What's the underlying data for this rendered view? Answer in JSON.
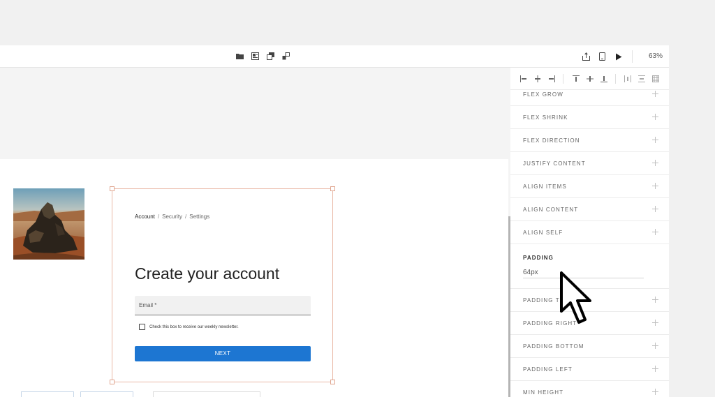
{
  "toolbar": {
    "center_icons": [
      "folder-icon",
      "layout-icon",
      "layers-icon",
      "components-icon"
    ],
    "right_icons": [
      "share-icon",
      "device-icon",
      "play-icon"
    ],
    "zoom": "63%"
  },
  "form": {
    "breadcrumb": [
      "Account",
      "Security",
      "Settings"
    ],
    "breadcrumb_separator": "/",
    "title": "Create your account",
    "email_label": "Email *",
    "newsletter_label": "Check this box to receive our weekly newsletter.",
    "next_label": "NEXT"
  },
  "panel": {
    "align_icons": [
      "align-left-icon",
      "align-center-horizontal-icon",
      "align-right-icon",
      "align-top-icon",
      "align-middle-icon",
      "align-bottom-icon",
      "distribute-horizontal-icon",
      "distribute-vertical-icon",
      "grid-icon"
    ],
    "props_top": [
      "FLEX GROW",
      "FLEX SHRINK",
      "FLEX DIRECTION",
      "JUSTIFY CONTENT",
      "ALIGN ITEMS",
      "ALIGN CONTENT",
      "ALIGN SELF"
    ],
    "padding": {
      "label": "PADDING",
      "value": "64px"
    },
    "props_bottom": [
      "PADDING TOP",
      "PADDING RIGHT",
      "PADDING BOTTOM",
      "PADDING LEFT",
      "MIN HEIGHT"
    ]
  },
  "colors": {
    "accent": "#1d76d2",
    "selection": "#eab8a6"
  }
}
